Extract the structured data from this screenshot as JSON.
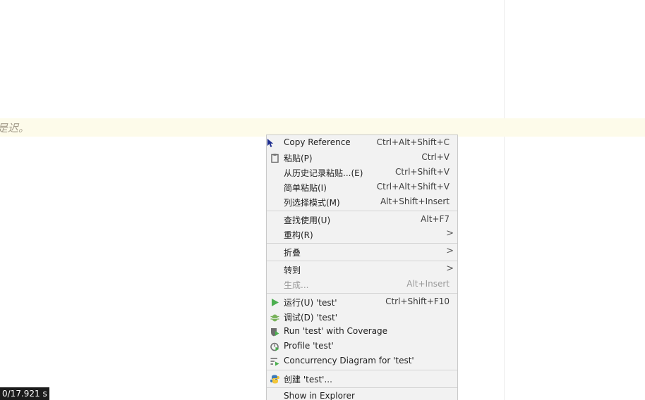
{
  "editor": {
    "code_fragment": "是迟。"
  },
  "status": {
    "timer": "0/17.921 s"
  },
  "context_menu": {
    "items": [
      {
        "label": "Copy Reference",
        "shortcut": "Ctrl+Alt+Shift+C"
      },
      {
        "label": "粘贴(P)",
        "shortcut": "Ctrl+V"
      },
      {
        "label": "从历史记录粘贴...(E)",
        "shortcut": "Ctrl+Shift+V"
      },
      {
        "label": "简单粘贴(I)",
        "shortcut": "Ctrl+Alt+Shift+V"
      },
      {
        "label": "列选择模式(M)",
        "shortcut": "Alt+Shift+Insert"
      },
      {
        "label": "查找使用(U)",
        "shortcut": "Alt+F7"
      },
      {
        "label": "重构(R)",
        "shortcut": ""
      },
      {
        "label": "折叠",
        "shortcut": ""
      },
      {
        "label": "转到",
        "shortcut": ""
      },
      {
        "label": "生成...",
        "shortcut": "Alt+Insert"
      },
      {
        "label": "运行(U) 'test'",
        "shortcut": "Ctrl+Shift+F10"
      },
      {
        "label": "调试(D) 'test'",
        "shortcut": ""
      },
      {
        "label": "Run 'test' with Coverage",
        "shortcut": ""
      },
      {
        "label": "Profile 'test'",
        "shortcut": ""
      },
      {
        "label": "Concurrency Diagram for 'test'",
        "shortcut": ""
      },
      {
        "label": "创建 'test'...",
        "shortcut": ""
      },
      {
        "label": "Show in Explorer",
        "shortcut": ""
      }
    ],
    "submenu_arrow": ">"
  },
  "colors": {
    "run_green": "#4caf50",
    "debug_green": "#7ab35c",
    "icon_gray": "#6e6e6e",
    "python_blue": "#3e7ab8",
    "python_yellow": "#f2c63c",
    "cursor_blue": "#1d2d8f"
  },
  "icons": {
    "copy_reference": "mouse-pointer-icon",
    "paste": "clipboard-icon",
    "run": "play-icon",
    "debug": "bug-icon",
    "coverage": "shield-run-icon",
    "profile": "profiler-icon",
    "concurrency": "diagram-icon",
    "create": "python-icon"
  }
}
